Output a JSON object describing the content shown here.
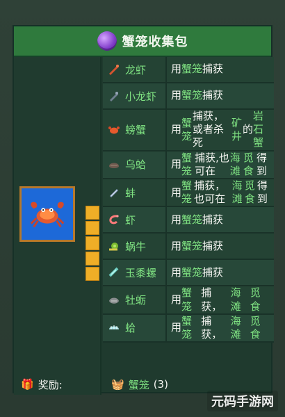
{
  "header": {
    "title": "蟹笼收集包",
    "icon": "purple-bundle-icon"
  },
  "items": [
    {
      "name": "龙虾",
      "icon": "lobster-icon",
      "desc_parts": [
        "用",
        "蟹笼",
        "捕获"
      ]
    },
    {
      "name": "小龙虾",
      "icon": "crayfish-icon",
      "desc_parts": [
        "用",
        "蟹笼",
        "捕获"
      ]
    },
    {
      "name": "螃蟹",
      "icon": "crab-icon",
      "desc_parts": [
        "用",
        "蟹笼",
        "捕获，或者杀死",
        "矿井",
        "的",
        "岩石蟹"
      ]
    },
    {
      "name": "乌蛤",
      "icon": "cockle-icon",
      "desc_parts": [
        "用",
        "蟹笼",
        "捕获,也可在",
        "海滩",
        " ",
        "觅食",
        "得到"
      ]
    },
    {
      "name": "蚌",
      "icon": "mussel-icon",
      "desc_parts": [
        "用",
        "蟹笼",
        "捕获，也可在",
        "海滩",
        " ",
        "觅食",
        "得到"
      ]
    },
    {
      "name": "虾",
      "icon": "shrimp-icon",
      "desc_parts": [
        "用",
        "蟹笼",
        "捕获"
      ]
    },
    {
      "name": "蜗牛",
      "icon": "snail-icon",
      "desc_parts": [
        "用",
        "蟹笼",
        "捕获"
      ]
    },
    {
      "name": "玉黍螺",
      "icon": "periwinkle-icon",
      "desc_parts": [
        "用",
        "蟹笼",
        "捕获"
      ]
    },
    {
      "name": "牡蛎",
      "icon": "oyster-icon",
      "desc_parts": [
        "用",
        "蟹笼",
        "捕获，",
        "海滩",
        "觅食"
      ]
    },
    {
      "name": "蛤",
      "icon": "clam-icon",
      "desc_parts": [
        "用",
        "蟹笼",
        "捕获，",
        "海滩",
        "觅食"
      ]
    }
  ],
  "reward": {
    "label": "奖励:",
    "item_name": "蟹笼",
    "quantity": "(3)"
  },
  "watermark": "元码手游网",
  "colors": {
    "header_green": "#2f7a3d",
    "panel_green": "#244334",
    "accent_green": "#7ee081",
    "slot_gold": "#efae27",
    "crab_bg_blue": "#1d69d8"
  }
}
